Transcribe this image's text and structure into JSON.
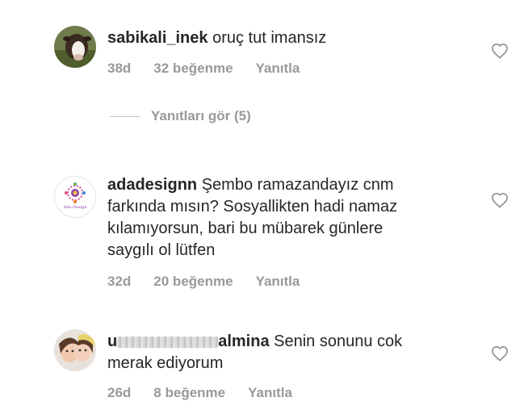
{
  "comments": [
    {
      "username": "sabikali_inek",
      "text": " oruç tut imansız",
      "age": "38d",
      "likes": "32 beğenme",
      "reply": "Yanıtla"
    },
    {
      "username": "adadesignn",
      "text_lines": [
        " Şembo ramazandayız cnm",
        "farkında mısın? Sosyallikten hadi namaz",
        "kılamıyorsun, bari bu mübarek günlere",
        "saygılı ol lütfen"
      ],
      "avatar_logo_text": "Ada Design",
      "age": "32d",
      "likes": "20 beğenme",
      "reply": "Yanıtla"
    },
    {
      "username_prefix": "u",
      "username_suffix": "almina",
      "text_lines": [
        " Senin sonunu cok",
        "merak ediyorum"
      ],
      "age": "26d",
      "likes": "8 beğenme",
      "reply": "Yanıtla"
    }
  ],
  "view_replies": "Yanıtları gör (5)",
  "icons": {
    "like": "heart-outline-icon"
  },
  "colors": {
    "text": "#262626",
    "meta": "#999999",
    "line": "#c7c7c7"
  }
}
